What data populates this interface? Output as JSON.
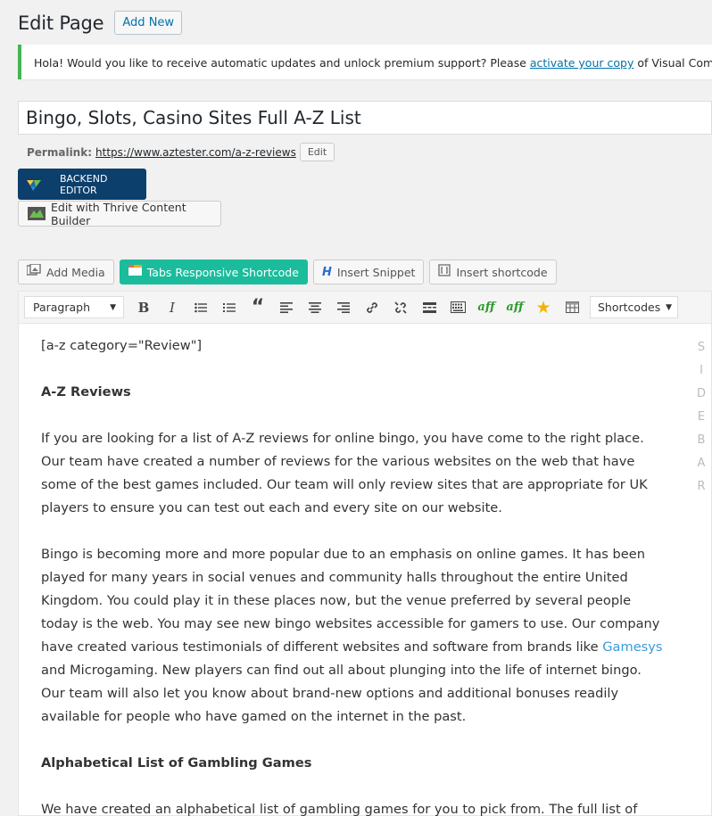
{
  "header": {
    "title": "Edit Page",
    "add_new": "Add New"
  },
  "notice": {
    "text_before": "Hola! Would you like to receive automatic updates and unlock premium support? Please ",
    "link": "activate your copy",
    "text_after": " of Visual Composer."
  },
  "post_title": "Bingo, Slots, Casino Sites Full A-Z List",
  "permalink": {
    "label": "Permalink:",
    "url": "https://www.aztester.com/a-z-reviews",
    "edit": "Edit"
  },
  "builders": {
    "backend_editor": "BACKEND EDITOR",
    "thrive": "Edit with Thrive Content Builder"
  },
  "media_buttons": {
    "add_media": "Add Media",
    "tabs_shortcode": "Tabs Responsive Shortcode",
    "insert_snippet": "Insert Snippet",
    "insert_shortcode": "Insert shortcode"
  },
  "toolbar": {
    "format": "Paragraph",
    "shortcodes": "Shortcodes",
    "aff1": "aff",
    "aff2": "aff"
  },
  "content": {
    "shortcode": "[a-z category=\"Review\"]",
    "heading1": "A-Z Reviews",
    "p1": "If you are looking for a list of A-Z reviews for online bingo, you have come to the right place. Our team have created a number of reviews for the various websites on the web that have some of the best games included. Our team will only review sites that are appropriate for UK players to ensure you can test out each and every site on our website.",
    "p2_before": "Bingo is becoming more and more popular due to an emphasis on online games. It has been played for many years in social venues and community halls throughout the entire United Kingdom. You could  play it in these places now, but the venue preferred by several people today is the web. You may see new bingo websites accessible for gamers to use. Our company have created various testimonials of different websites and software from brands like ",
    "p2_link": "Gamesys",
    "p2_after": " and Microgaming. New players can find out all about plunging into the life of internet bingo. Our team will also let you know about brand-new options and additional bonuses readily available for people who have gamed on the internet in the past.",
    "heading2": "Alphabetical List of Gambling Games",
    "p3": "We have created an alphabetical list of gambling games for you to pick from. The full list of"
  },
  "sidebar_letters": [
    "S",
    "I",
    "D",
    "E",
    "B",
    "A",
    "R"
  ]
}
